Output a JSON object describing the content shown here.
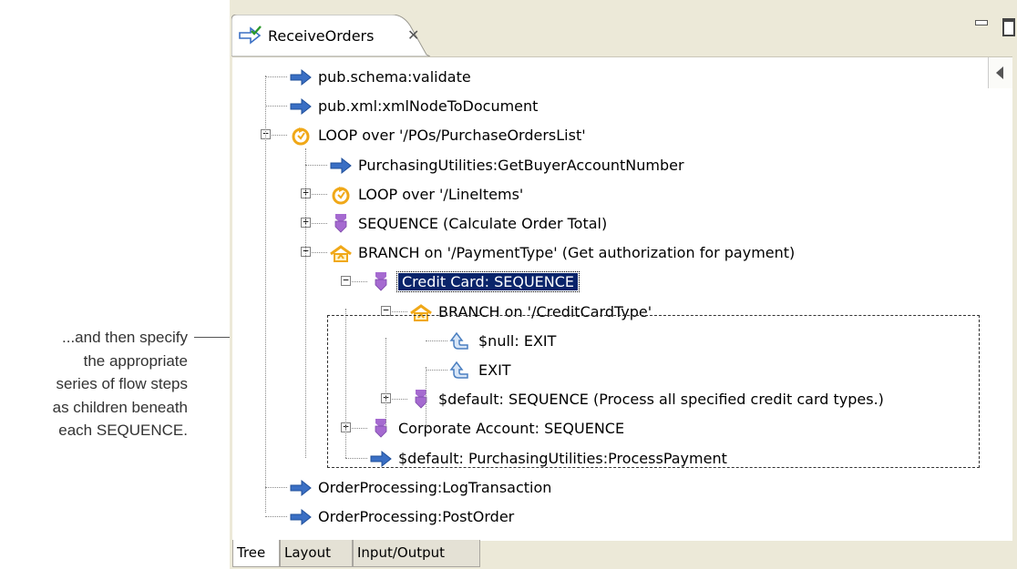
{
  "annotation": {
    "lines": [
      "...and then specify",
      "the appropriate",
      "series of flow steps",
      "as children beneath",
      "each SEQUENCE."
    ]
  },
  "window": {
    "tab_title": "ReceiveOrders",
    "tab_close_glyph": "✕",
    "tab_icon": "flow-service-icon"
  },
  "tree": {
    "rows": [
      {
        "label": "pub.schema:validate",
        "icon": "invoke-arrow-icon"
      },
      {
        "label": "pub.xml:xmlNodeToDocument",
        "icon": "invoke-arrow-icon"
      },
      {
        "label": "LOOP over '/POs/PurchaseOrdersList'",
        "icon": "loop-icon",
        "expander": "⊟"
      },
      {
        "label": "PurchasingUtilities:GetBuyerAccountNumber",
        "icon": "invoke-arrow-icon"
      },
      {
        "label": "LOOP over '/LineItems'",
        "icon": "loop-icon",
        "expander": "⊞"
      },
      {
        "label": "SEQUENCE (Calculate Order Total)",
        "icon": "sequence-icon",
        "expander": "⊞"
      },
      {
        "label": "BRANCH on '/PaymentType' (Get authorization for payment)",
        "icon": "branch-icon",
        "expander": "⊟"
      },
      {
        "label": "Credit Card: SEQUENCE",
        "icon": "sequence-icon",
        "expander": "⊟",
        "selected": true
      },
      {
        "label": "BRANCH on '/CreditCardType'",
        "icon": "branch-icon",
        "expander": "⊟"
      },
      {
        "label": "$null: EXIT",
        "icon": "exit-icon"
      },
      {
        "label": "EXIT",
        "icon": "exit-icon"
      },
      {
        "label": "$default: SEQUENCE (Process all specified credit card types.)",
        "icon": "sequence-icon",
        "expander": "⊞"
      },
      {
        "label": "Corporate Account: SEQUENCE",
        "icon": "sequence-icon",
        "expander": "⊞"
      },
      {
        "label": "$default: PurchasingUtilities:ProcessPayment",
        "icon": "invoke-arrow-icon"
      },
      {
        "label": "OrderProcessing:LogTransaction",
        "icon": "invoke-arrow-icon"
      },
      {
        "label": "OrderProcessing:PostOrder",
        "icon": "invoke-arrow-icon"
      }
    ]
  },
  "bottom_tabs": [
    {
      "label": "Tree",
      "active": true
    },
    {
      "label": "Layout",
      "active": false
    },
    {
      "label": "Input/Output",
      "active": false
    }
  ],
  "colors": {
    "selection": "#0a246a",
    "invoke_arrow": "#3a6fc4",
    "sequence": "#a56ad0",
    "loop_branch": "#f0a818",
    "exit": "#4a7fc0"
  }
}
